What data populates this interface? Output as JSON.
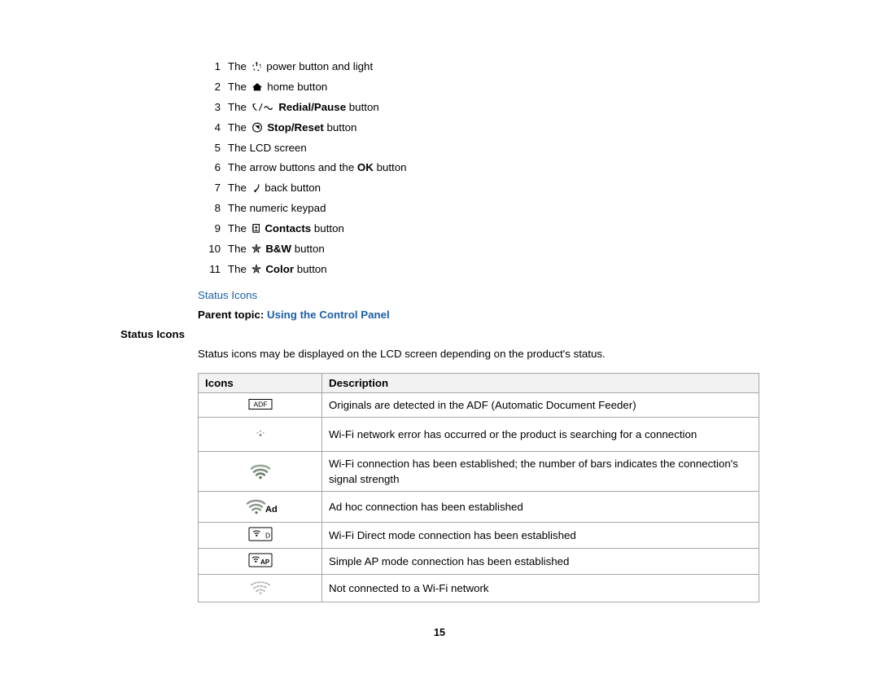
{
  "legend": {
    "items": [
      {
        "num": "1",
        "pre": "The ",
        "icon": "power-icon",
        "mid": " power button and light",
        "bold": "",
        "post": ""
      },
      {
        "num": "2",
        "pre": "The ",
        "icon": "home-icon",
        "mid": " home button",
        "bold": "",
        "post": ""
      },
      {
        "num": "3",
        "pre": "The ",
        "icon": "redial-pause-icon",
        "mid": " ",
        "bold": "Redial/Pause",
        "post": " button"
      },
      {
        "num": "4",
        "pre": "The ",
        "icon": "stop-reset-icon",
        "mid": " ",
        "bold": "Stop/Reset",
        "post": " button"
      },
      {
        "num": "5",
        "pre": "The LCD screen",
        "icon": "",
        "mid": "",
        "bold": "",
        "post": ""
      },
      {
        "num": "6",
        "pre": "The arrow buttons and the ",
        "icon": "",
        "mid": "",
        "bold": "OK",
        "post": " button"
      },
      {
        "num": "7",
        "pre": "The ",
        "icon": "back-icon",
        "mid": " back button",
        "bold": "",
        "post": ""
      },
      {
        "num": "8",
        "pre": "The numeric keypad",
        "icon": "",
        "mid": "",
        "bold": "",
        "post": ""
      },
      {
        "num": "9",
        "pre": "The ",
        "icon": "contacts-icon",
        "mid": " ",
        "bold": "Contacts",
        "post": " button"
      },
      {
        "num": "10",
        "pre": "The ",
        "icon": "bw-start-icon",
        "mid": " ",
        "bold": "B&W",
        "post": " button"
      },
      {
        "num": "11",
        "pre": "The ",
        "icon": "color-start-icon",
        "mid": " ",
        "bold": "Color",
        "post": " button"
      }
    ]
  },
  "links": {
    "status_icons": "Status Icons",
    "parent_topic_label": "Parent topic:",
    "parent_topic_link": "Using the Control Panel"
  },
  "section": {
    "heading": "Status Icons",
    "intro": "Status icons may be displayed on the LCD screen depending on the product's status."
  },
  "table": {
    "headers": [
      "Icons",
      "Description"
    ],
    "rows": [
      {
        "icon": "adf-icon",
        "desc": "Originals are detected in the ADF (Automatic Document Feeder)"
      },
      {
        "icon": "wifi-error-icon",
        "desc": "Wi-Fi network error has occurred or the product is searching for a connection"
      },
      {
        "icon": "wifi-connected-icon",
        "desc": "Wi-Fi connection has been established; the number of bars indicates the connection's signal strength"
      },
      {
        "icon": "wifi-adhoc-icon",
        "desc": "Ad hoc connection has been established"
      },
      {
        "icon": "wifi-direct-icon",
        "desc": "Wi-Fi Direct mode connection has been established"
      },
      {
        "icon": "simple-ap-icon",
        "desc": "Simple AP mode connection has been established"
      },
      {
        "icon": "wifi-off-icon",
        "desc": "Not connected to a Wi-Fi network"
      }
    ]
  },
  "footer": {
    "page_number": "15"
  },
  "colors": {
    "link": "#1b5fa8",
    "table_border": "#a6a6a6",
    "header_bg": "#f2f2f2"
  }
}
